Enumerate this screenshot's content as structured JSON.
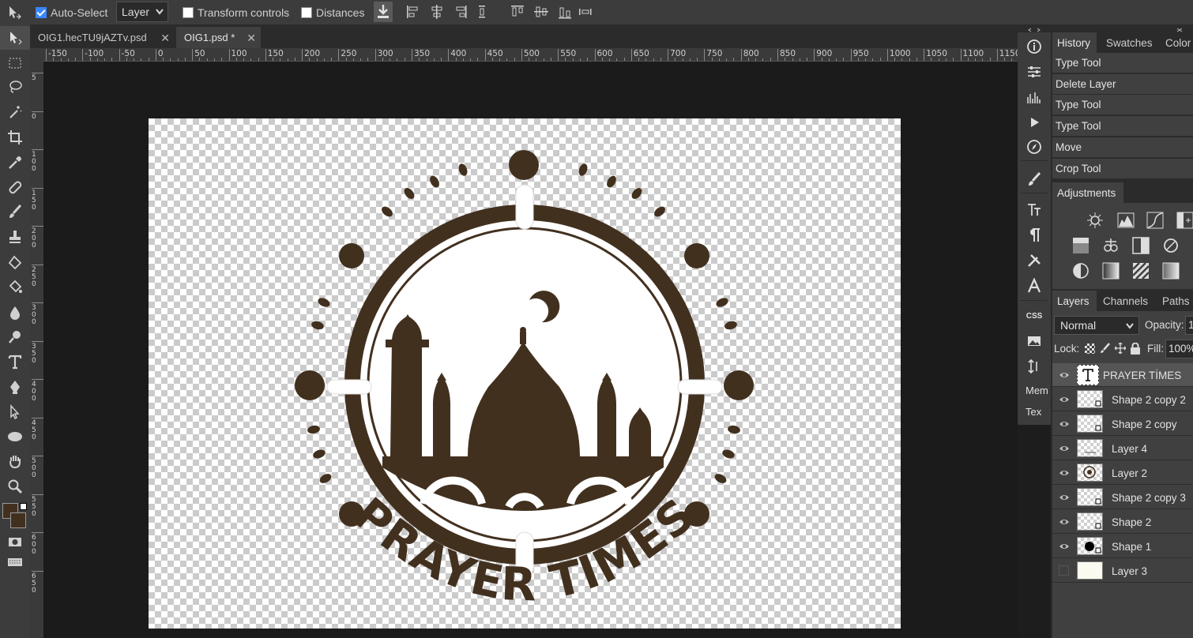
{
  "options_bar": {
    "auto_select_label": "Auto-Select",
    "auto_select_checked": true,
    "target_select": "Layer",
    "transform_controls_label": "Transform controls",
    "distances_label": "Distances"
  },
  "tabs": [
    {
      "label": "OIG1.hecTU9jAZTv.psd",
      "close": "✕"
    },
    {
      "label": "OIG1.psd *",
      "close": "✕"
    }
  ],
  "ruler": {
    "h_labels": [
      "-150",
      "-100",
      "-50",
      "0",
      "50",
      "100",
      "150",
      "200",
      "250",
      "300",
      "350",
      "400",
      "450",
      "500",
      "550",
      "600",
      "650",
      "700",
      "750",
      "800",
      "850",
      "900",
      "950",
      "1000",
      "1050",
      "1100",
      "1150"
    ],
    "v_labels": [
      "5",
      "0",
      "1\n0\n0",
      "1\n5\n0",
      "2\n0\n0",
      "2\n5\n0",
      "3\n0\n0",
      "3\n5\n0",
      "4\n0\n0",
      "4\n5\n0",
      "5\n0\n0",
      "5\n5\n0",
      "6\n0\n0",
      "6\n5\n0"
    ]
  },
  "artwork": {
    "text": "PRAYER TIMES",
    "brown": "#42301f",
    "white": "#ffffff"
  },
  "mini_panel": {
    "memory_label": "Mem",
    "text_label": "Tex",
    "css_label": "CSS"
  },
  "history_tabs": [
    "History",
    "Swatches",
    "Color"
  ],
  "history_items": [
    "Type Tool",
    "Delete Layer",
    "Type Tool",
    "Type Tool",
    "Move",
    "Crop Tool"
  ],
  "adjustments_tab": "Adjustments",
  "layers_tabs": [
    "Layers",
    "Channels",
    "Paths"
  ],
  "blend_mode": "Normal",
  "opacity_label": "Opacity:",
  "opacity_value": "1",
  "lock_label": "Lock:",
  "fill_label": "Fill:",
  "fill_value": "100%",
  "layers": [
    {
      "name": "PRAYER TİMES",
      "visible": true,
      "type": "text",
      "selected": true
    },
    {
      "name": "Shape 2 copy 2",
      "visible": true,
      "type": "shape"
    },
    {
      "name": "Shape 2 copy",
      "visible": true,
      "type": "shape"
    },
    {
      "name": "Layer 4",
      "visible": true,
      "type": "raster"
    },
    {
      "name": "Layer 2",
      "visible": true,
      "type": "raster"
    },
    {
      "name": "Shape 2 copy 3",
      "visible": true,
      "type": "shape"
    },
    {
      "name": "Shape 2",
      "visible": true,
      "type": "shape"
    },
    {
      "name": "Shape 1",
      "visible": true,
      "type": "shape"
    },
    {
      "name": "Layer 3",
      "visible": false,
      "type": "fill"
    }
  ],
  "colors": {
    "foreground": "#42301f",
    "background": "#42301f"
  }
}
